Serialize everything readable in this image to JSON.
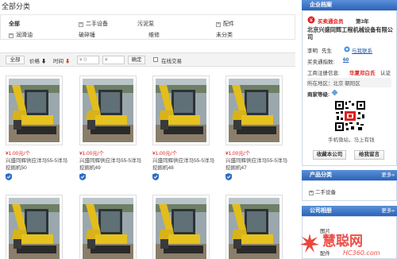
{
  "page_title": "全部分类",
  "categories": {
    "all": "全部",
    "items": [
      {
        "label": "二手设备",
        "sign": "+"
      },
      {
        "label": "污泥泵",
        "sign": ""
      },
      {
        "label": "配件",
        "sign": "+"
      },
      {
        "label": "润滑油",
        "sign": "+"
      },
      {
        "label": "破碎锤",
        "sign": ""
      },
      {
        "label": "维修",
        "sign": ""
      },
      {
        "label": "未分类",
        "sign": ""
      }
    ]
  },
  "filter": {
    "all_label": "全部",
    "price_label": "价格",
    "time_label": "时间",
    "price_from_placeholder": "¥ 0",
    "price_to_placeholder": "¥",
    "confirm_label": "确定",
    "online_trade_label": "在线交易"
  },
  "products": [
    {
      "price": "¥1.00元/个",
      "name": "兴盛同辉供应洋马55-5洋马挖掘机50"
    },
    {
      "price": "¥1.00元/个",
      "name": "兴盛同辉供应洋马55-5洋马挖掘机49"
    },
    {
      "price": "¥1.00元/个",
      "name": "兴盛同辉供应洋马55-5洋马挖掘机48"
    },
    {
      "price": "¥1.00元/个",
      "name": "兴盛同辉供应洋马55-5洋马挖掘机47"
    },
    {
      "price": "",
      "name": ""
    },
    {
      "price": "",
      "name": ""
    },
    {
      "price": "",
      "name": ""
    },
    {
      "price": "",
      "name": ""
    }
  ],
  "sidebar": {
    "company_section": "企业档案",
    "vip_label": "买卖通会员",
    "vip_year": "第3年",
    "company_name": "北京兴盛同辉工程机械设备有限公司",
    "contact_name": "李明",
    "contact_title": "先生",
    "chat_label": "与我联系",
    "credit_label": "买卖通指数:",
    "credit_value": "60",
    "business_label": "工商注册信息:",
    "business_value": "华夏邓白氏",
    "business_suffix": "认证",
    "location_label": "所在地区：",
    "location_value": "北京 朝阳区",
    "partner_label": "商家等级:",
    "qr_caption_1": "手机微站",
    "qr_caption_2": "马上有钱",
    "save_company": "收藏本公司",
    "leave_message": "给我留言",
    "products_section": "产品分类",
    "more_label": "更多»",
    "product_category": "二手设备",
    "album_section": "公司相册",
    "album_item": "图片",
    "album_item_2": "配件",
    "watermark_text": "慧聪网",
    "watermark_url": "HC360.com"
  }
}
